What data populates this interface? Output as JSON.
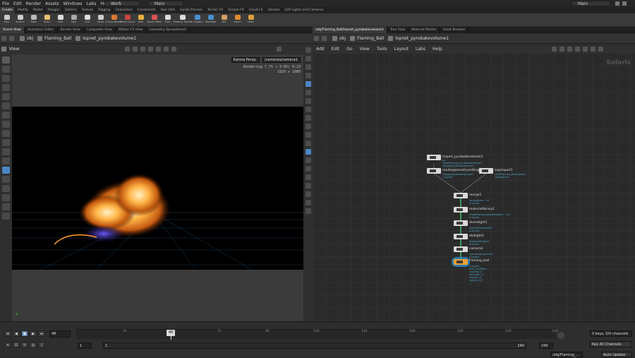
{
  "menubar": {
    "items": [
      "File",
      "Edit",
      "Render",
      "Assets",
      "Windows",
      "Labs",
      "Help"
    ],
    "desktop": "Work",
    "session": "Main",
    "right_session": "Main"
  },
  "shelf": {
    "tabs": [
      "Create",
      "Modify",
      "Model",
      "Polygon",
      "Deform",
      "Texture",
      "Rigging",
      "Characters",
      "Constraints",
      "Hair Utils",
      "Guide Process",
      "Terrain FX",
      "Simple FX",
      "Cloud FX",
      "Volume",
      "LOP Lights and Cameras"
    ],
    "tools": [
      "Box",
      "Sphere",
      "Tube",
      "Torus",
      "Grid",
      "Null",
      "Line",
      "Circle",
      "Curve Bezier",
      "Draw Curve",
      "Path",
      "Spray Paint",
      "Font",
      "Platonic Solids",
      "L-System",
      "Metaball",
      "File",
      "Spiral",
      "Helix"
    ]
  },
  "left_pane": {
    "tabs": [
      "Scene View",
      "Animation Editor",
      "Render View",
      "Composite View",
      "Motion FX View",
      "Geometry Spreadsheet"
    ],
    "path": [
      "obj",
      "Flaming_Ball",
      "lopnet_pyrobakevolume1"
    ],
    "view_label": "View",
    "renderer": "Karma Persp",
    "camera": "/cameras/camera1",
    "render_status": "Rendering  7.7%  (-3:06)  0:23",
    "resolution": "1920 x 1080"
  },
  "right_pane": {
    "tabs": [
      "/obj/Flaming_Ball/lopnet_pyrobakevolume1",
      "Tree View",
      "Material Palette",
      "Asset Browser"
    ],
    "path": [
      "obj",
      "Flaming_Ball",
      "lopnet_pyrobakevolume1"
    ],
    "menu": [
      "Add",
      "Edit",
      "Go",
      "View",
      "Tools",
      "Layout",
      "Labs",
      "Help"
    ],
    "context_label": "Solaris"
  },
  "nodes": {
    "import": {
      "name": "import_pyrobakevolume1",
      "sub": [
        "op",
        "/obj/Flaming_pyrobakevolume1",
        "/stage/pyrobakevolume1"
      ]
    },
    "render": {
      "name": "rendergeometrysettings1",
      "sub": [
        "/stage/pyrobakevolume1",
        "2 layers"
      ]
    },
    "sop": {
      "name": "sopimport1",
      "sub": [
        "/obj/Flaming_Ball/sphere",
        "/obj/sphere"
      ]
    },
    "merge": {
      "name": "merge1",
      "sub": [
        "/obj/sphere...10",
        "4 layers"
      ]
    },
    "matlib": {
      "name": "materiallibrary1",
      "sub": [
        "/materials/pyrospokelight1....10",
        "4 layers"
      ]
    },
    "dome": {
      "name": "domelight1",
      "sub": [
        "/lights/domelight1",
        "4 layers"
      ]
    },
    "dist": {
      "name": "distlight1",
      "sub": [
        "/lights/distlight1",
        "4 layers"
      ]
    },
    "camera": {
      "name": "camera1",
      "sub": [
        "/cameras/camera1",
        "4 layers"
      ]
    },
    "karma": {
      "name": "Flaming_ball",
      "sub": [
        "4 layers",
        "RPS_v0.8ffms",
        "Loading 2...",
        "samples=1",
        "repeat=0",
        "npixel=1/3",
        "..."
      ]
    }
  },
  "timeline": {
    "current_frame": "48",
    "ticks": [
      "24",
      "48",
      "72",
      "96",
      "120",
      "144",
      "168",
      "192",
      "216",
      "240"
    ],
    "start": "1",
    "start2": "1",
    "end": "240",
    "end2": "240",
    "keys": "0 keys, 0/0 channels",
    "key_all": "Key All Channels",
    "path": "/obj/Flaming_...",
    "auto_update": "Auto Update"
  }
}
